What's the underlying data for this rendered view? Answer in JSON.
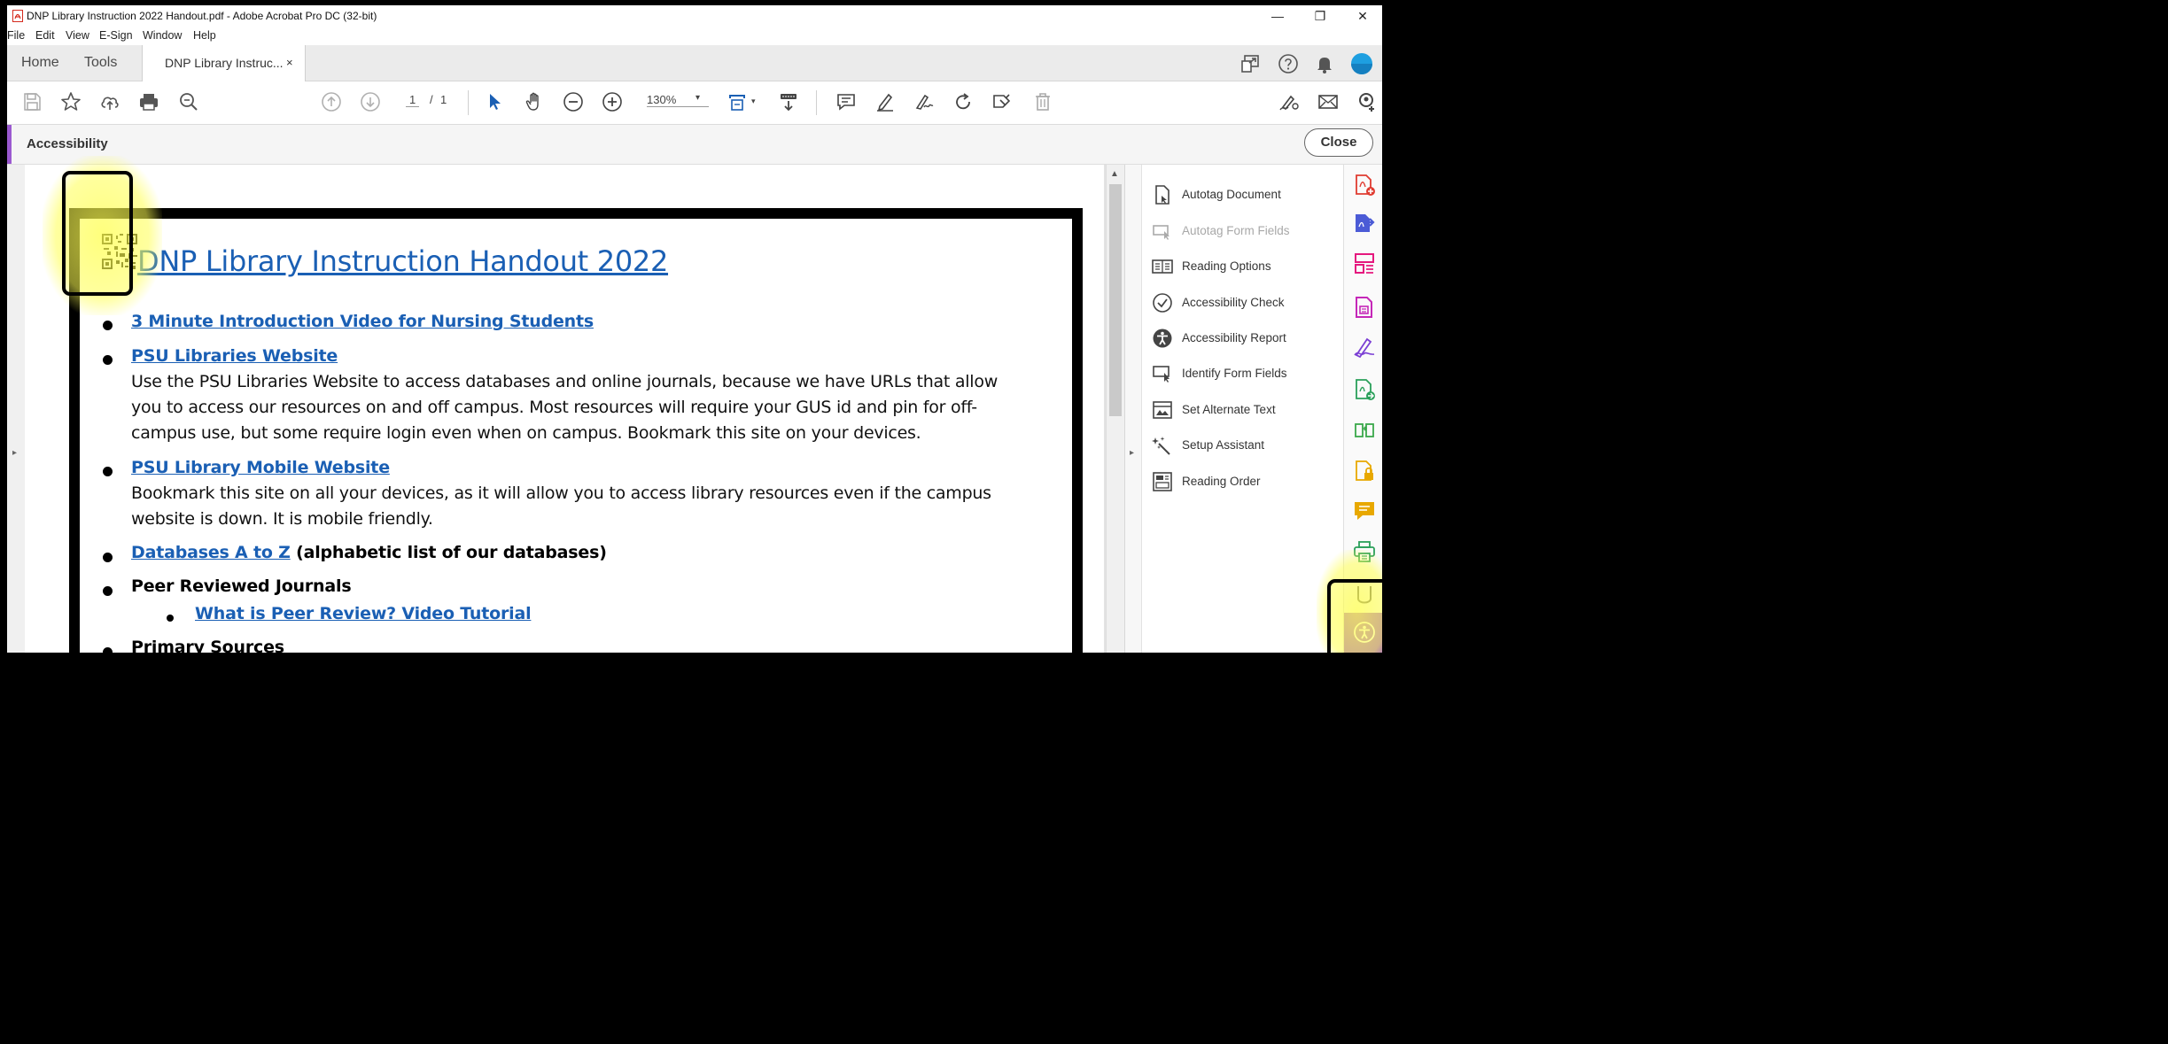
{
  "window": {
    "title": "DNP Library Instruction 2022 Handout.pdf - Adobe Acrobat Pro DC (32-bit)",
    "controls": {
      "minimize": "—",
      "restore": "❐",
      "close": "✕"
    }
  },
  "menu": [
    "File",
    "Edit",
    "View",
    "E-Sign",
    "Window",
    "Help"
  ],
  "tabs": {
    "home": "Home",
    "tools": "Tools",
    "document": "DNP Library Instruc...",
    "close": "×"
  },
  "toolbar": {
    "page_current": "1",
    "page_sep": "/",
    "page_total": "1",
    "zoom": "130%"
  },
  "panel_header": {
    "title": "Accessibility",
    "close_label": "Close"
  },
  "document": {
    "title": "DNP Library Instruction Handout 2022",
    "items": [
      {
        "link": "3 Minute Introduction Video for Nursing Students"
      },
      {
        "link": "PSU Libraries Website",
        "lines": [
          "Use the PSU Libraries Website to access databases and online journals, because we have URLs that allow",
          "you to access our resources on and off campus. Most resources will require your GUS id and pin for off-",
          "campus use, but some require login even when on campus. Bookmark this site on your devices."
        ]
      },
      {
        "link": "PSU Library Mobile Website",
        "lines": [
          "Bookmark this site on all your devices, as it will allow you to access library resources even if the campus",
          "website is down. It is mobile friendly."
        ]
      },
      {
        "link": "Databases A to Z",
        "suffix": " (alphabetic list of our databases)"
      },
      {
        "text": "Peer Reviewed Journals"
      },
      {
        "sublink": "What is Peer Review? Video Tutorial"
      },
      {
        "text": "Primary Sources"
      }
    ]
  },
  "accessibility_tools": [
    {
      "label": "Autotag Document",
      "icon": "autotag-document-icon",
      "enabled": true
    },
    {
      "label": "Autotag Form Fields",
      "icon": "autotag-form-fields-icon",
      "enabled": false
    },
    {
      "label": "Reading Options",
      "icon": "reading-options-icon",
      "enabled": true
    },
    {
      "label": "Accessibility Check",
      "icon": "accessibility-check-icon",
      "enabled": true
    },
    {
      "label": "Accessibility Report",
      "icon": "accessibility-report-icon",
      "enabled": true
    },
    {
      "label": "Identify Form Fields",
      "icon": "identify-form-fields-icon",
      "enabled": true
    },
    {
      "label": "Set Alternate Text",
      "icon": "set-alternate-text-icon",
      "enabled": true
    },
    {
      "label": "Setup Assistant",
      "icon": "setup-assistant-icon",
      "enabled": true
    },
    {
      "label": "Reading Order",
      "icon": "reading-order-icon",
      "enabled": true
    }
  ],
  "colors": {
    "accent_purple": "#9b59d0",
    "link_blue": "#1a5fb4",
    "highlight_yellow": "#ffff50"
  }
}
